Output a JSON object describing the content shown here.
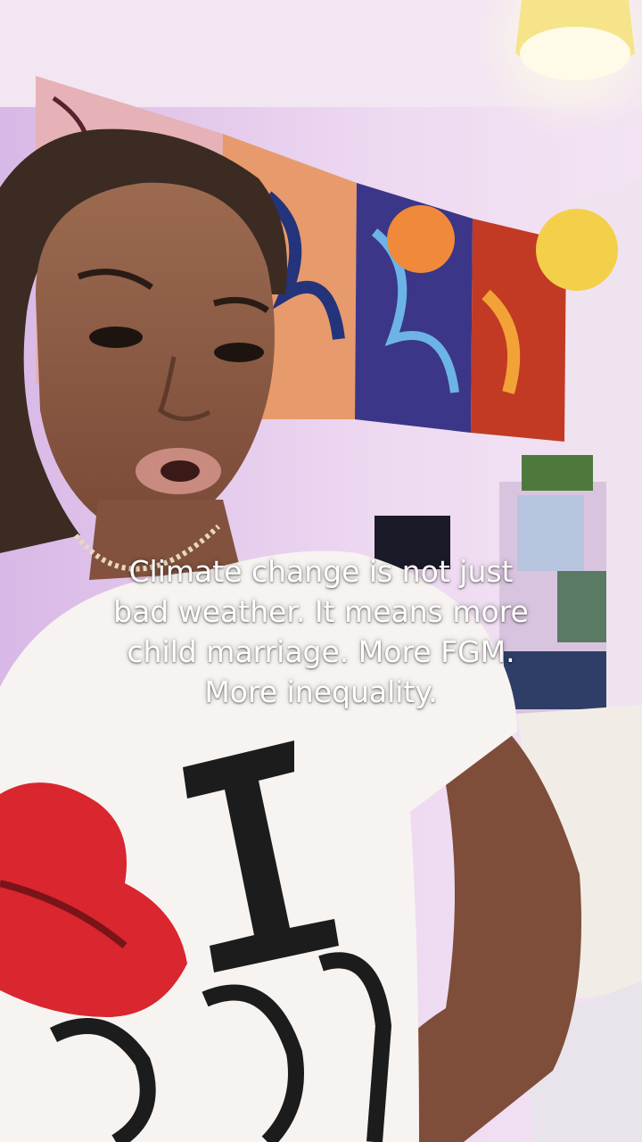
{
  "video": {
    "caption_lines": [
      "Climate change is not just",
      "bad weather. It means more",
      "child marriage. More FGM.",
      "More inequality."
    ]
  },
  "colors": {
    "wall": "#e9d2ee",
    "ceiling": "#f2e6f2",
    "poster_red": "#c34a3a",
    "poster_blue": "#2b3a8c",
    "lamp_orange": "#f08a3a",
    "lamp_yellow": "#f4cf4a",
    "shirt": "#f6f3f1",
    "lips_red": "#d9262f",
    "skin": "#8a5a44",
    "caption_text": "#ffffff"
  }
}
